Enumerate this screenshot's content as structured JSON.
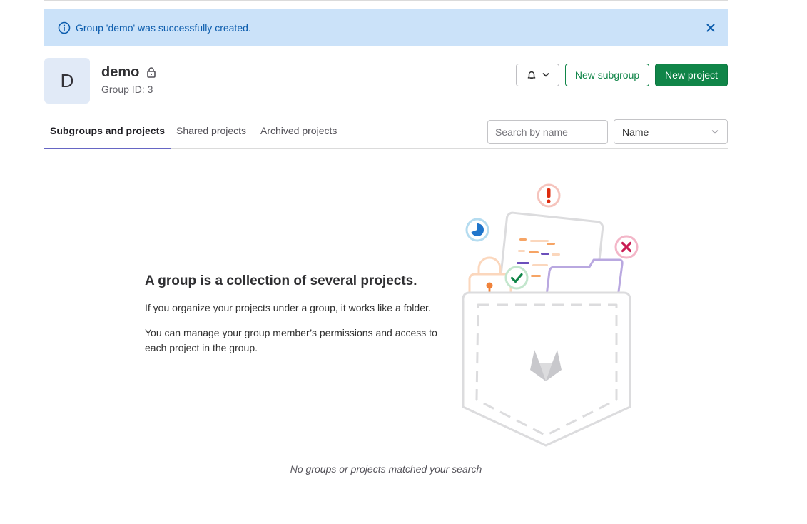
{
  "alert": {
    "message": "Group 'demo' was successfully created."
  },
  "group": {
    "avatar_letter": "D",
    "name": "demo",
    "id_text": "Group ID: 3"
  },
  "header_actions": {
    "new_subgroup": "New subgroup",
    "new_project": "New project"
  },
  "tabs": [
    {
      "label": "Subgroups and projects",
      "active": true
    },
    {
      "label": "Shared projects",
      "active": false
    },
    {
      "label": "Archived projects",
      "active": false
    }
  ],
  "filters": {
    "search_placeholder": "Search by name",
    "sort_selected": "Name"
  },
  "empty_state": {
    "title": "A group is a collection of several projects.",
    "line1": "If you organize your projects under a group, it works like a folder.",
    "line2": "You can manage your group member’s permissions and access to each project in the group.",
    "no_results": "No groups or projects matched your search"
  },
  "colors": {
    "alert_bg": "#cbe2f9",
    "primary_green": "#108548",
    "tab_active_underline": "#6666c4"
  },
  "icons": [
    "info-icon",
    "close-icon",
    "lock-icon",
    "bell-icon",
    "chevron-down-icon"
  ]
}
